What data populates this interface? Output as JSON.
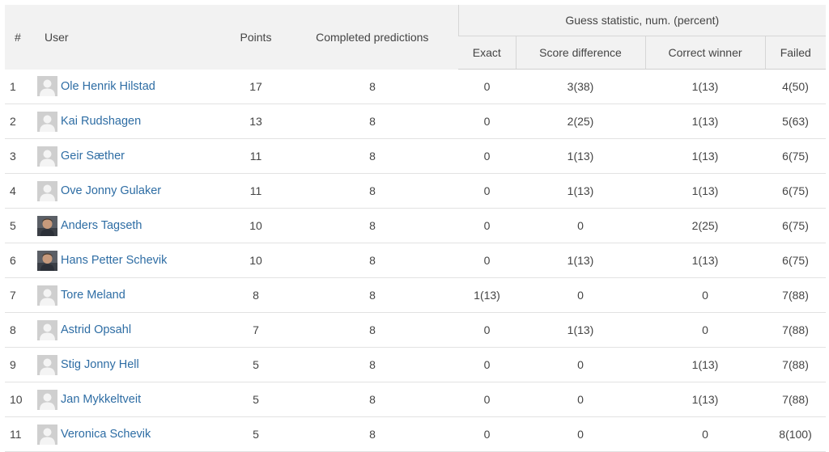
{
  "table": {
    "headers": {
      "rank": "#",
      "user": "User",
      "points": "Points",
      "completed": "Completed predictions",
      "group": "Guess statistic, num. (percent)",
      "exact": "Exact",
      "score_difference": "Score difference",
      "correct_winner": "Correct winner",
      "failed": "Failed"
    },
    "rows": [
      {
        "rank": "1",
        "name": "Ole Henrik Hilstad",
        "avatar": "default-avatar-icon",
        "points": "17",
        "completed": "8",
        "exact": "0",
        "score_difference": "3(38)",
        "correct_winner": "1(13)",
        "failed": "4(50)"
      },
      {
        "rank": "2",
        "name": "Kai Rudshagen",
        "avatar": "default-avatar-icon",
        "points": "13",
        "completed": "8",
        "exact": "0",
        "score_difference": "2(25)",
        "correct_winner": "1(13)",
        "failed": "5(63)"
      },
      {
        "rank": "3",
        "name": "Geir Sæther",
        "avatar": "default-avatar-icon",
        "points": "11",
        "completed": "8",
        "exact": "0",
        "score_difference": "1(13)",
        "correct_winner": "1(13)",
        "failed": "6(75)"
      },
      {
        "rank": "4",
        "name": "Ove Jonny Gulaker",
        "avatar": "default-avatar-icon",
        "points": "11",
        "completed": "8",
        "exact": "0",
        "score_difference": "1(13)",
        "correct_winner": "1(13)",
        "failed": "6(75)"
      },
      {
        "rank": "5",
        "name": "Anders Tagseth",
        "avatar": "photo-avatar-icon",
        "points": "10",
        "completed": "8",
        "exact": "0",
        "score_difference": "0",
        "correct_winner": "2(25)",
        "failed": "6(75)"
      },
      {
        "rank": "6",
        "name": "Hans Petter Schevik",
        "avatar": "photo-avatar-icon",
        "points": "10",
        "completed": "8",
        "exact": "0",
        "score_difference": "1(13)",
        "correct_winner": "1(13)",
        "failed": "6(75)"
      },
      {
        "rank": "7",
        "name": "Tore Meland",
        "avatar": "default-avatar-icon",
        "points": "8",
        "completed": "8",
        "exact": "1(13)",
        "score_difference": "0",
        "correct_winner": "0",
        "failed": "7(88)"
      },
      {
        "rank": "8",
        "name": "Astrid Opsahl",
        "avatar": "default-avatar-icon",
        "points": "7",
        "completed": "8",
        "exact": "0",
        "score_difference": "1(13)",
        "correct_winner": "0",
        "failed": "7(88)"
      },
      {
        "rank": "9",
        "name": "Stig Jonny Hell",
        "avatar": "default-avatar-icon",
        "points": "5",
        "completed": "8",
        "exact": "0",
        "score_difference": "0",
        "correct_winner": "1(13)",
        "failed": "7(88)"
      },
      {
        "rank": "10",
        "name": "Jan Mykkeltveit",
        "avatar": "default-avatar-icon",
        "points": "5",
        "completed": "8",
        "exact": "0",
        "score_difference": "0",
        "correct_winner": "1(13)",
        "failed": "7(88)"
      },
      {
        "rank": "11",
        "name": "Veronica Schevik",
        "avatar": "default-avatar-icon",
        "points": "5",
        "completed": "8",
        "exact": "0",
        "score_difference": "0",
        "correct_winner": "0",
        "failed": "8(100)"
      }
    ]
  },
  "colors": {
    "header_bg": "#f2f2f2",
    "link": "#2e6da4",
    "text": "#444444",
    "row_border": "#e2e2e2"
  }
}
